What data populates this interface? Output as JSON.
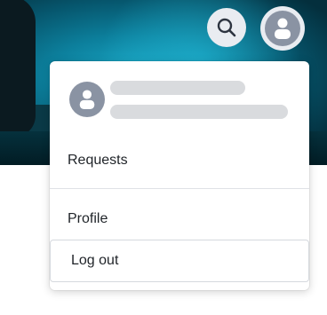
{
  "header": {
    "search_icon": "search-icon",
    "avatar_icon": "user-icon"
  },
  "menu": {
    "items": [
      {
        "label": "Requests"
      },
      {
        "label": "Profile"
      },
      {
        "label": "Log out"
      }
    ]
  },
  "colors": {
    "hero_accent": "#0c7f9c",
    "button_bg": "#e9ecf1",
    "avatar_gray": "#8a93a3",
    "skeleton": "#d9dbde"
  }
}
